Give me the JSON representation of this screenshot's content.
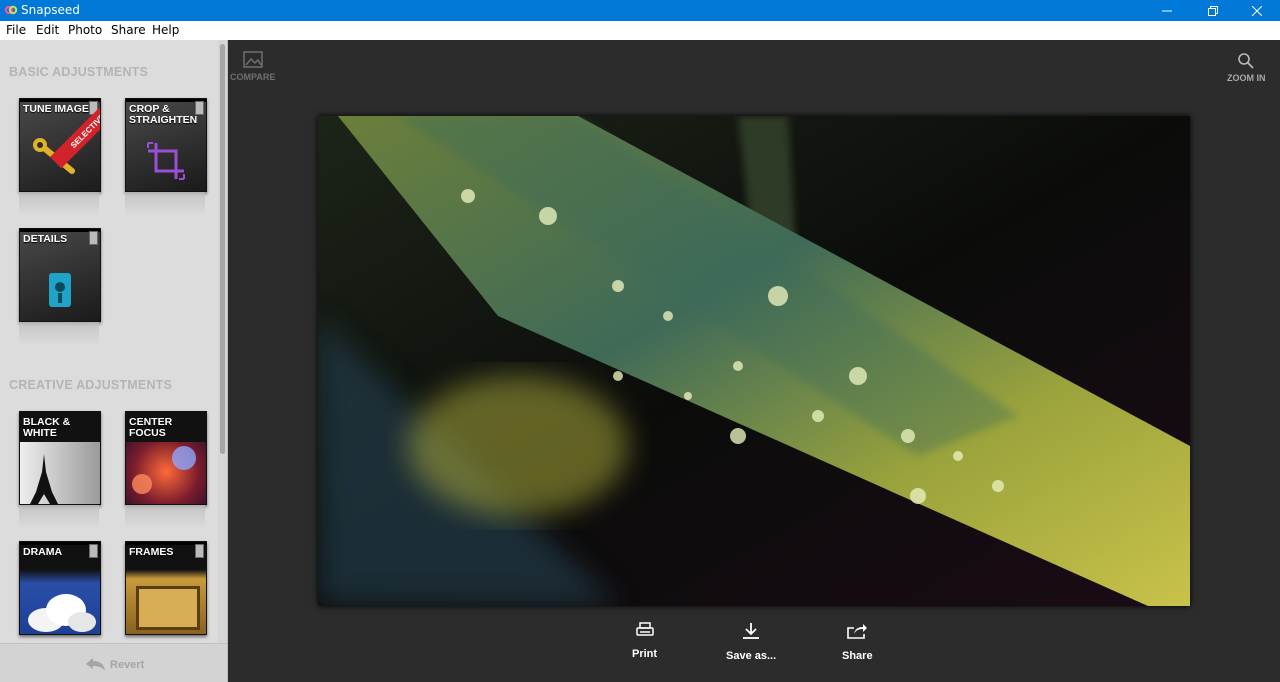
{
  "window": {
    "title": "Snapseed"
  },
  "menu": [
    "File",
    "Edit",
    "Photo",
    "Share",
    "Help"
  ],
  "sidebar": {
    "basic_title": "BASIC ADJUSTMENTS",
    "creative_title": "CREATIVE ADJUSTMENTS",
    "basic_tools": [
      {
        "label": "TUNE IMAGE",
        "badge": "SELECTIVE"
      },
      {
        "label": "CROP & STRAIGHTEN"
      },
      {
        "label": "DETAILS"
      }
    ],
    "creative_tools": [
      {
        "label": "BLACK & WHITE"
      },
      {
        "label": "CENTER FOCUS"
      },
      {
        "label": "DRAMA"
      },
      {
        "label": "FRAMES"
      }
    ],
    "revert_label": "Revert"
  },
  "toolbar": {
    "compare_label": "COMPARE",
    "zoom_label": "ZOOM IN"
  },
  "actions": {
    "print_label": "Print",
    "save_label": "Save as...",
    "share_label": "Share"
  },
  "colors": {
    "titlebar": "#0078d7",
    "accent_purple": "#9b4fd6",
    "selective_red": "#d2232a"
  }
}
